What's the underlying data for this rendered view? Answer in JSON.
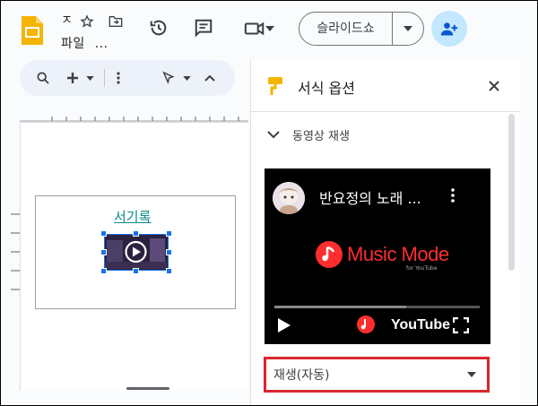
{
  "header": {
    "doc_title": "ㅈ",
    "menu_label": "파일",
    "menu_more": "...",
    "slideshow_label": "슬라이드쇼"
  },
  "slide": {
    "link_text": "서기록"
  },
  "panel": {
    "title": "서식 옵션",
    "section_label": "동영상 재생",
    "video_title": "반요정의 노래 ...",
    "overlay_logo_text": "Music Mode",
    "overlay_logo_sub": "for YouTube",
    "youtube_label": "YouTube",
    "progress_fraction": 0.64,
    "playback_option": "재생(자동)"
  },
  "colors": {
    "accent": "#1a73e8",
    "share_bg": "#c2e7ff",
    "highlight_border": "#d9262f",
    "logo_red": "#ff2e2e",
    "slides_yellow": "#f4b400"
  }
}
